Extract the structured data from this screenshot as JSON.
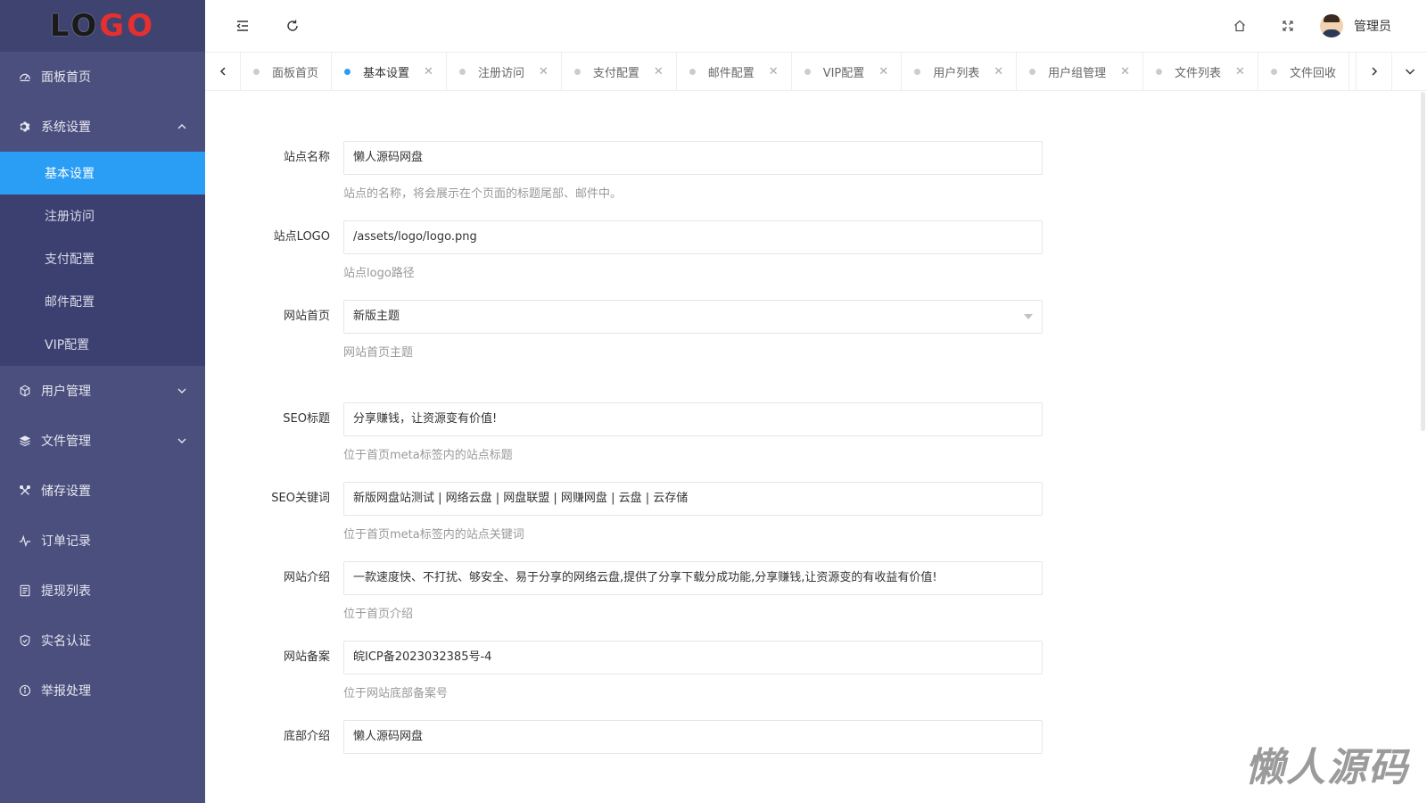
{
  "logo": {
    "text_dark": "LO",
    "text_red": "GO"
  },
  "sidebar": {
    "items": [
      {
        "label": "面板首页",
        "icon": "dashboard-icon"
      },
      {
        "label": "系统设置",
        "icon": "gear-icon",
        "expanded": true,
        "children": [
          {
            "label": "基本设置",
            "active": true
          },
          {
            "label": "注册访问"
          },
          {
            "label": "支付配置"
          },
          {
            "label": "邮件配置"
          },
          {
            "label": "VIP配置"
          }
        ]
      },
      {
        "label": "用户管理",
        "icon": "cube-icon",
        "expandable": true
      },
      {
        "label": "文件管理",
        "icon": "layers-icon",
        "expandable": true
      },
      {
        "label": "储存设置",
        "icon": "tools-icon"
      },
      {
        "label": "订单记录",
        "icon": "pulse-icon"
      },
      {
        "label": "提现列表",
        "icon": "list-icon"
      },
      {
        "label": "实名认证",
        "icon": "shield-icon"
      },
      {
        "label": "举报处理",
        "icon": "info-icon"
      }
    ]
  },
  "header": {
    "user_name": "管理员"
  },
  "tabs": [
    {
      "label": "面板首页",
      "closable": false,
      "active": false
    },
    {
      "label": "基本设置",
      "closable": true,
      "active": true
    },
    {
      "label": "注册访问",
      "closable": true,
      "active": false
    },
    {
      "label": "支付配置",
      "closable": true,
      "active": false
    },
    {
      "label": "邮件配置",
      "closable": true,
      "active": false
    },
    {
      "label": "VIP配置",
      "closable": true,
      "active": false
    },
    {
      "label": "用户列表",
      "closable": true,
      "active": false
    },
    {
      "label": "用户组管理",
      "closable": true,
      "active": false
    },
    {
      "label": "文件列表",
      "closable": true,
      "active": false
    },
    {
      "label": "文件回收",
      "closable": false,
      "active": false
    }
  ],
  "form": {
    "site_name": {
      "label": "站点名称",
      "value": "懒人源码网盘",
      "hint": "站点的名称，将会展示在个页面的标题尾部、邮件中。"
    },
    "site_logo": {
      "label": "站点LOGO",
      "value": "/assets/logo/logo.png",
      "hint": "站点logo路径"
    },
    "homepage": {
      "label": "网站首页",
      "value": "新版主题",
      "hint": "网站首页主题"
    },
    "seo_title": {
      "label": "SEO标题",
      "value": "分享赚钱，让资源变有价值!",
      "hint": "位于首页meta标签内的站点标题"
    },
    "seo_keywords": {
      "label": "SEO关键词",
      "value": "新版网盘站测试 | 网络云盘 | 网盘联盟 | 网赚网盘 | 云盘 | 云存储",
      "hint": "位于首页meta标签内的站点关键词"
    },
    "site_intro": {
      "label": "网站介绍",
      "value": "一款速度快、不打扰、够安全、易于分享的网络云盘,提供了分享下载分成功能,分享赚钱,让资源变的有收益有价值!",
      "hint": "位于首页介绍"
    },
    "site_icp": {
      "label": "网站备案",
      "value": "皖ICP备2023032385号-4",
      "hint": "位于网站底部备案号"
    },
    "footer_intro": {
      "label": "底部介绍",
      "value": "懒人源码网盘"
    }
  },
  "watermark": "懒人源码",
  "colors": {
    "sidebar": "#4b4f7d",
    "submenu": "#3c4070",
    "accent": "#2a9df4",
    "logo_red": "#e63030"
  }
}
